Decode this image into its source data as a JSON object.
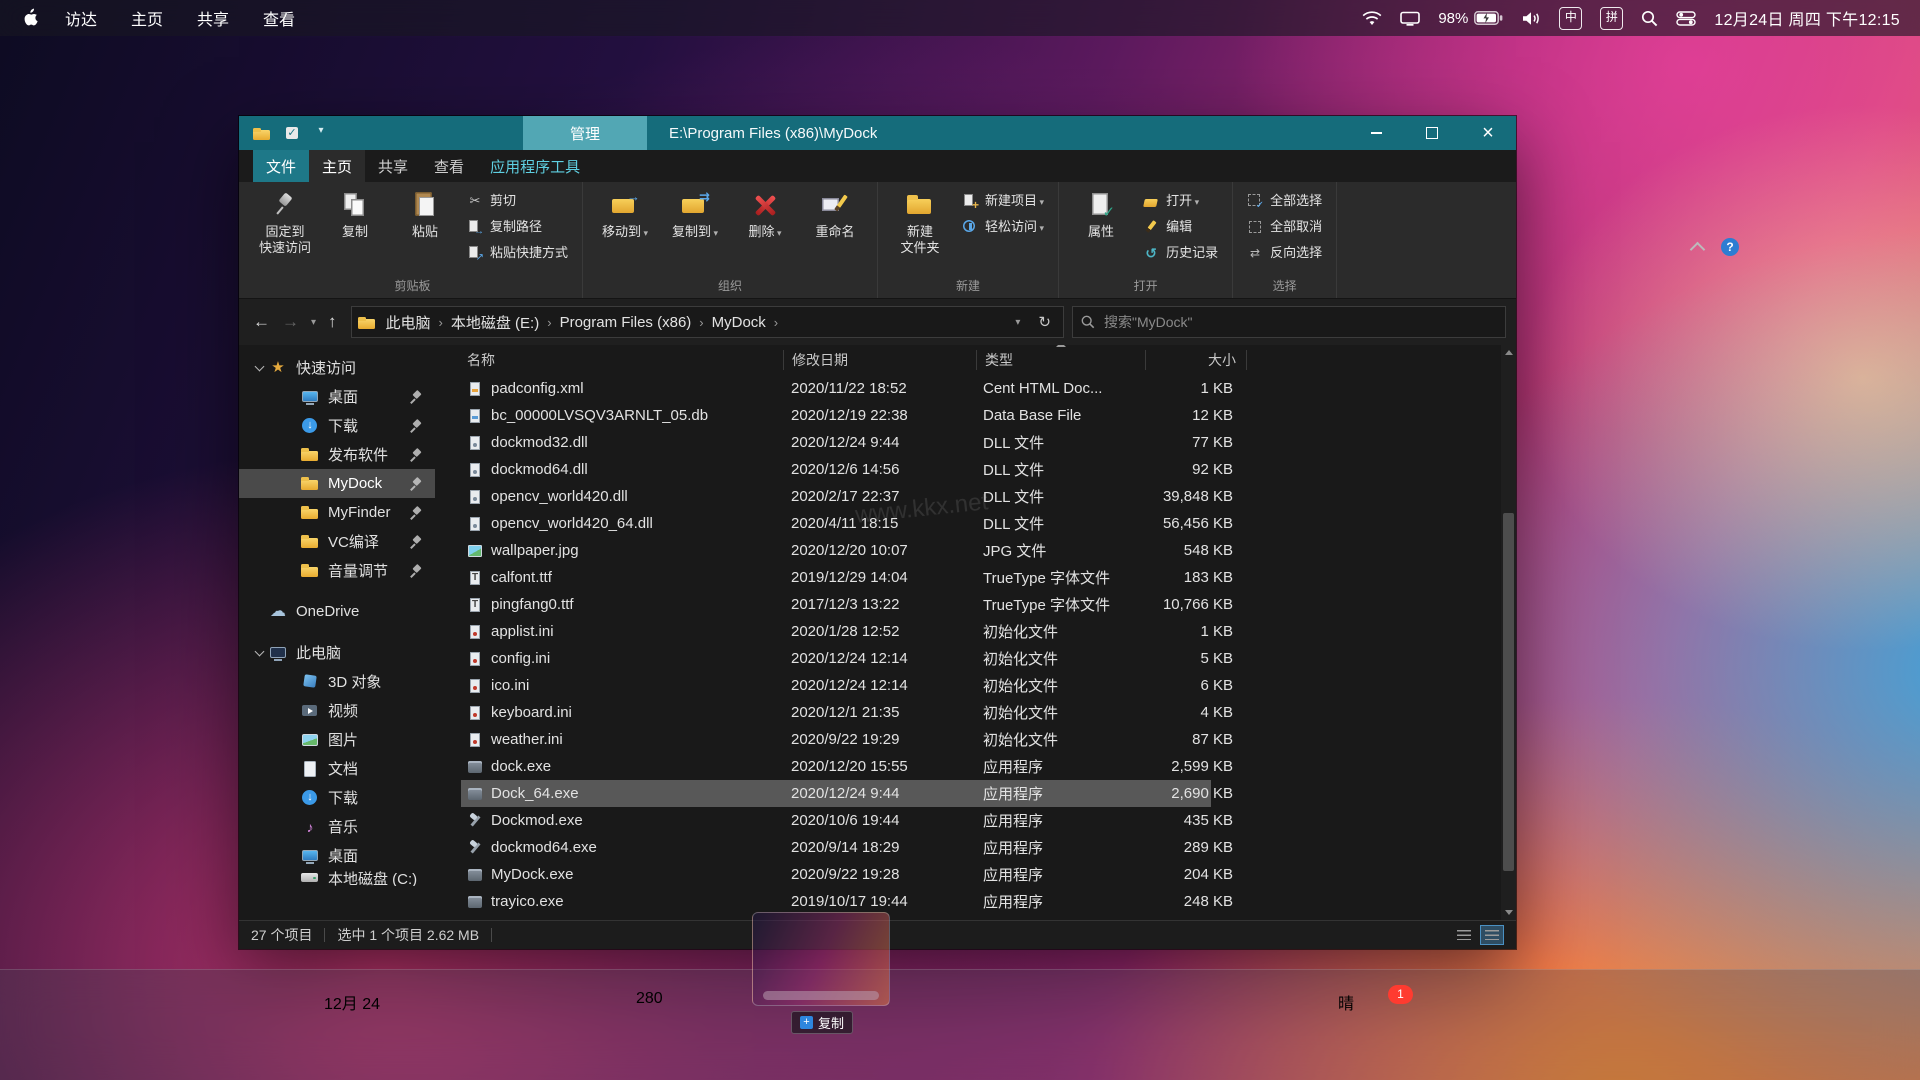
{
  "menu_bar": {
    "menus": [
      "访达",
      "主页",
      "共享",
      "查看"
    ],
    "status": {
      "battery": "98%",
      "ime1": "中",
      "ime2": "拼",
      "datetime": "12月24日 周四 下午12:15"
    }
  },
  "explorer": {
    "titlebar": {
      "context_tab": "管理",
      "title": "E:\\Program Files (x86)\\MyDock"
    },
    "ribbon_tabs": [
      {
        "label": "文件",
        "kind": "file"
      },
      {
        "label": "主页",
        "kind": "active"
      },
      {
        "label": "共享"
      },
      {
        "label": "查看"
      },
      {
        "label": "应用程序工具",
        "kind": "contextual"
      }
    ],
    "ribbon": {
      "groups": [
        {
          "name": "剪贴板",
          "large": [
            {
              "label": "固定到\n快速访问",
              "icon": "pin"
            },
            {
              "label": "复制",
              "icon": "copy"
            },
            {
              "label": "粘贴",
              "icon": "paste"
            }
          ],
          "small": [
            {
              "label": "剪切",
              "icon": "cut"
            },
            {
              "label": "复制路径",
              "icon": "path"
            },
            {
              "label": "粘贴快捷方式",
              "icon": "shortcut"
            }
          ]
        },
        {
          "name": "组织",
          "large": [
            {
              "label": "移动到",
              "icon": "move",
              "menu": true
            },
            {
              "label": "复制到",
              "icon": "copyto",
              "menu": true
            },
            {
              "label": "删除",
              "icon": "delete",
              "menu": true
            },
            {
              "label": "重命名",
              "icon": "rename"
            }
          ],
          "small": []
        },
        {
          "name": "新建",
          "large": [
            {
              "label": "新建\n文件夹",
              "icon": "newfolder"
            }
          ],
          "small": [
            {
              "label": "新建项目",
              "icon": "newitem",
              "menu": true
            },
            {
              "label": "轻松访问",
              "icon": "easyaccess",
              "menu": true
            }
          ]
        },
        {
          "name": "打开",
          "large": [
            {
              "label": "属性",
              "icon": "properties"
            }
          ],
          "small": [
            {
              "label": "打开",
              "icon": "open",
              "menu": true
            },
            {
              "label": "编辑",
              "icon": "edit"
            },
            {
              "label": "历史记录",
              "icon": "history"
            }
          ]
        },
        {
          "name": "选择",
          "large": [],
          "small": [
            {
              "label": "全部选择",
              "icon": "selectall"
            },
            {
              "label": "全部取消",
              "icon": "selectnone"
            },
            {
              "label": "反向选择",
              "icon": "invert"
            }
          ]
        }
      ]
    },
    "address": {
      "crumbs": [
        "此电脑",
        "本地磁盘 (E:)",
        "Program Files (x86)",
        "MyDock"
      ]
    },
    "search_placeholder": "搜索\"MyDock\"",
    "columns": [
      "名称",
      "修改日期",
      "类型",
      "大小"
    ],
    "sidebar": [
      {
        "label": "快速访问",
        "icon": "star",
        "expander": true,
        "name": "quick-access"
      },
      {
        "label": "桌面",
        "icon": "desktop",
        "level": 1,
        "pinned": true,
        "name": "desktop"
      },
      {
        "label": "下载",
        "icon": "download",
        "level": 1,
        "pinned": true,
        "name": "downloads"
      },
      {
        "label": "发布软件",
        "icon": "folder",
        "level": 1,
        "pinned": true,
        "name": "release"
      },
      {
        "label": "MyDock",
        "icon": "folder",
        "level": 1,
        "pinned": true,
        "selected": true,
        "name": "mydock"
      },
      {
        "label": "MyFinder",
        "icon": "folder",
        "level": 1,
        "pinned": true,
        "name": "myfinder"
      },
      {
        "label": "VC编译",
        "icon": "folder",
        "level": 1,
        "pinned": true,
        "name": "vc"
      },
      {
        "label": "音量调节",
        "icon": "folder",
        "level": 1,
        "pinned": true,
        "name": "volume"
      },
      {
        "label": "OneDrive",
        "icon": "cloud",
        "gapAbove": true,
        "name": "onedrive"
      },
      {
        "label": "此电脑",
        "icon": "computer",
        "expander": true,
        "gapAbove": true,
        "name": "this-pc"
      },
      {
        "label": "3D 对象",
        "icon": "cube",
        "level": 1,
        "name": "3d-objects"
      },
      {
        "label": "视频",
        "icon": "video",
        "level": 1,
        "name": "videos"
      },
      {
        "label": "图片",
        "icon": "picture",
        "level": 1,
        "name": "pictures"
      },
      {
        "label": "文档",
        "icon": "docfile",
        "level": 1,
        "name": "documents"
      },
      {
        "label": "下载",
        "icon": "download",
        "level": 1,
        "name": "downloads-2"
      },
      {
        "label": "音乐",
        "icon": "musicnote",
        "level": 1,
        "name": "music"
      },
      {
        "label": "桌面",
        "icon": "desktop",
        "level": 1,
        "name": "desktop-2"
      },
      {
        "label": "本地磁盘 (C:)",
        "icon": "disk",
        "level": 1,
        "clipped": true,
        "name": "local-disk-c"
      }
    ],
    "files": [
      {
        "name": "padconfig.xml",
        "date": "2020/11/22 18:52",
        "type": "Cent HTML Doc...",
        "size": "1 KB",
        "icon": "xml"
      },
      {
        "name": "bc_00000LVSQV3ARNLT_05.db",
        "date": "2020/12/19 22:38",
        "type": "Data Base File",
        "size": "12 KB",
        "icon": "db"
      },
      {
        "name": "dockmod32.dll",
        "date": "2020/12/24 9:44",
        "type": "DLL 文件",
        "size": "77 KB",
        "icon": "dll"
      },
      {
        "name": "dockmod64.dll",
        "date": "2020/12/6 14:56",
        "type": "DLL 文件",
        "size": "92 KB",
        "icon": "dll"
      },
      {
        "name": "opencv_world420.dll",
        "date": "2020/2/17 22:37",
        "type": "DLL 文件",
        "size": "39,848 KB",
        "icon": "dll"
      },
      {
        "name": "opencv_world420_64.dll",
        "date": "2020/4/11 18:15",
        "type": "DLL 文件",
        "size": "56,456 KB",
        "icon": "dll"
      },
      {
        "name": "wallpaper.jpg",
        "date": "2020/12/20 10:07",
        "type": "JPG 文件",
        "size": "548 KB",
        "icon": "jpg"
      },
      {
        "name": "calfont.ttf",
        "date": "2019/12/29 14:04",
        "type": "TrueType 字体文件",
        "size": "183 KB",
        "icon": "ttf"
      },
      {
        "name": "pingfang0.ttf",
        "date": "2017/12/3 13:22",
        "type": "TrueType 字体文件",
        "size": "10,766 KB",
        "icon": "ttf"
      },
      {
        "name": "applist.ini",
        "date": "2020/1/28 12:52",
        "type": "初始化文件",
        "size": "1 KB",
        "icon": "ini"
      },
      {
        "name": "config.ini",
        "date": "2020/12/24 12:14",
        "type": "初始化文件",
        "size": "5 KB",
        "icon": "ini"
      },
      {
        "name": "ico.ini",
        "date": "2020/12/24 12:14",
        "type": "初始化文件",
        "size": "6 KB",
        "icon": "ini"
      },
      {
        "name": "keyboard.ini",
        "date": "2020/12/1 21:35",
        "type": "初始化文件",
        "size": "4 KB",
        "icon": "ini"
      },
      {
        "name": "weather.ini",
        "date": "2020/9/22 19:29",
        "type": "初始化文件",
        "size": "87 KB",
        "icon": "ini"
      },
      {
        "name": "dock.exe",
        "date": "2020/12/20 15:55",
        "type": "应用程序",
        "size": "2,599 KB",
        "icon": "app"
      },
      {
        "name": "Dock_64.exe",
        "date": "2020/12/24 9:44",
        "type": "应用程序",
        "size": "2,690 KB",
        "icon": "app",
        "selected": true
      },
      {
        "name": "Dockmod.exe",
        "date": "2020/10/6 19:44",
        "type": "应用程序",
        "size": "435 KB",
        "icon": "tool"
      },
      {
        "name": "dockmod64.exe",
        "date": "2020/9/14 18:29",
        "type": "应用程序",
        "size": "289 KB",
        "icon": "tool"
      },
      {
        "name": "MyDock.exe",
        "date": "2020/9/22 19:28",
        "type": "应用程序",
        "size": "204 KB",
        "icon": "app"
      },
      {
        "name": "trayico.exe",
        "date": "2019/10/17 19:44",
        "type": "应用程序",
        "size": "248 KB",
        "icon": "app"
      }
    ],
    "status": {
      "items": "27 个项目",
      "selection": "选中 1 个项目 2.62 MB"
    }
  },
  "watermark": "www.kkx.net",
  "drag_ghost": {
    "plus": "+",
    "label": "复制"
  },
  "dock": {
    "items": [
      {
        "name": "start"
      },
      {
        "name": "edge"
      },
      {
        "name": "contacts"
      },
      {
        "name": "mail"
      },
      {
        "name": "calendar",
        "sub": "12月",
        "text": "24"
      },
      {
        "name": "reminders"
      },
      {
        "name": "messages"
      },
      {
        "name": "colors"
      },
      {
        "name": "maps",
        "sub": "280"
      },
      {
        "name": "facetime"
      },
      {
        "name": "music"
      },
      {
        "name": "books"
      },
      {
        "name": "appstore"
      },
      {
        "name": "photos"
      },
      {
        "name": "settings"
      },
      {
        "name": "qq"
      },
      {
        "name": "clock"
      },
      {
        "name": "weather",
        "text": "晴",
        "badge": "1"
      },
      {
        "name": "windows"
      }
    ]
  }
}
